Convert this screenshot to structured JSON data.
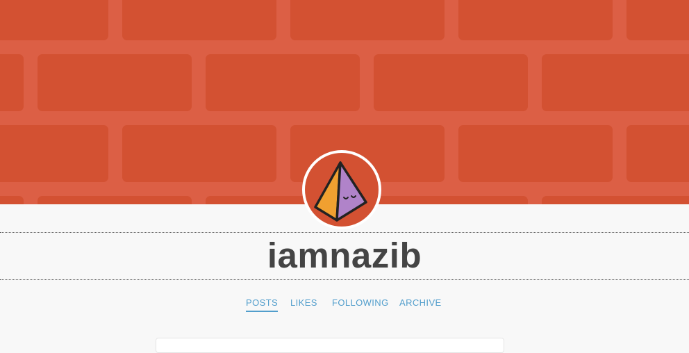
{
  "blog": {
    "title": "iamnazib",
    "header_color": "#dc5f45",
    "brick_color": "#d35132",
    "link_color": "#529ecc"
  },
  "avatar": {
    "icon": "pyramid-icon",
    "left_face_color": "#f0a030",
    "right_face_color": "#b083c9"
  },
  "nav": {
    "items": [
      {
        "label": "POSTS",
        "active": true
      },
      {
        "label": "LIKES",
        "active": false
      },
      {
        "label": "FOLLOWING",
        "active": false
      },
      {
        "label": "ARCHIVE",
        "active": false
      }
    ]
  }
}
